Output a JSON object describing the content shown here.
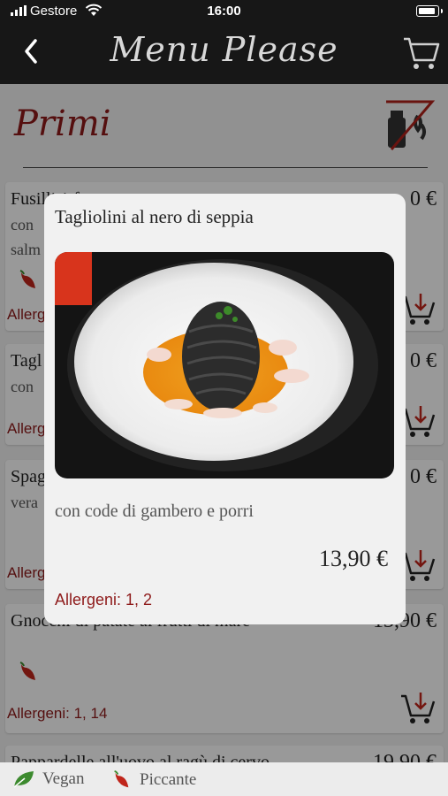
{
  "status": {
    "carrier": "Gestore",
    "time": "16:00"
  },
  "nav": {
    "title": "Menu Please"
  },
  "section": {
    "title": "Primi"
  },
  "items": [
    {
      "name": "Fusilli 1 f...",
      "desc1": "con",
      "desc2": "salm",
      "price": "0 €",
      "allergens": "Allerge"
    },
    {
      "name": "Tagl",
      "desc1": "con",
      "price": "0 €",
      "allergens": "Allerg"
    },
    {
      "name": "Spag",
      "desc1": "vera",
      "price": "0 €",
      "allergens": "Allerg"
    },
    {
      "name": "Gnocchi di patate ai frutti di mare",
      "price": "13,90 €",
      "allergens": "Allergeni: 1, 14"
    },
    {
      "name": "Pappardelle all'uovo al ragù di cervo",
      "price": "19,90 €"
    }
  ],
  "legend": {
    "vegan": "Vegan",
    "spicy": "Piccante"
  },
  "modal": {
    "title": "Tagliolini al nero di seppia",
    "description": "con code di gambero e porri",
    "price": "13,90 €",
    "allergens": "Allergeni: 1, 2"
  },
  "colors": {
    "accent": "#8e1a1a",
    "navbar": "#171717",
    "vegan": "#3c8a2e",
    "chili": "#c0251b"
  }
}
